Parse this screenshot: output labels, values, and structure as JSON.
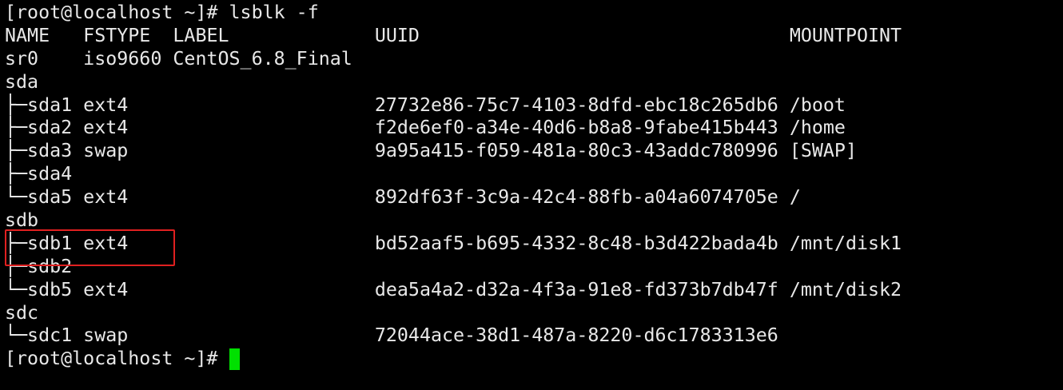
{
  "terminal": {
    "lines": [
      "[root@localhost ~]# lsblk -f",
      "NAME   FSTYPE  LABEL             UUID                                 MOUNTPOINT",
      "sr0    iso9660 CentOS_6.8_Final",
      "sda",
      "├─sda1 ext4                      27732e86-75c7-4103-8dfd-ebc18c265db6 /boot",
      "├─sda2 ext4                      f2de6ef0-a34e-40d6-b8a8-9fabe415b443 /home",
      "├─sda3 swap                      9a95a415-f059-481a-80c3-43addc780996 [SWAP]",
      "├─sda4",
      "└─sda5 ext4                      892df63f-3c9a-42c4-88fb-a04a6074705e /",
      "sdb",
      "├─sdb1 ext4                      bd52aaf5-b695-4332-8c48-b3d422bada4b /mnt/disk1",
      "├─sdb2",
      "└─sdb5 ext4                      dea5a4a2-d32a-4f3a-91e8-fd373b7db47f /mnt/disk2",
      "sdc",
      "└─sdc1 swap                      72044ace-38d1-487a-8220-d6c1783313e6"
    ],
    "prompt": "[root@localhost ~]# "
  },
  "colors": {
    "cursor": "#00e000",
    "highlight_border": "#e02020"
  }
}
